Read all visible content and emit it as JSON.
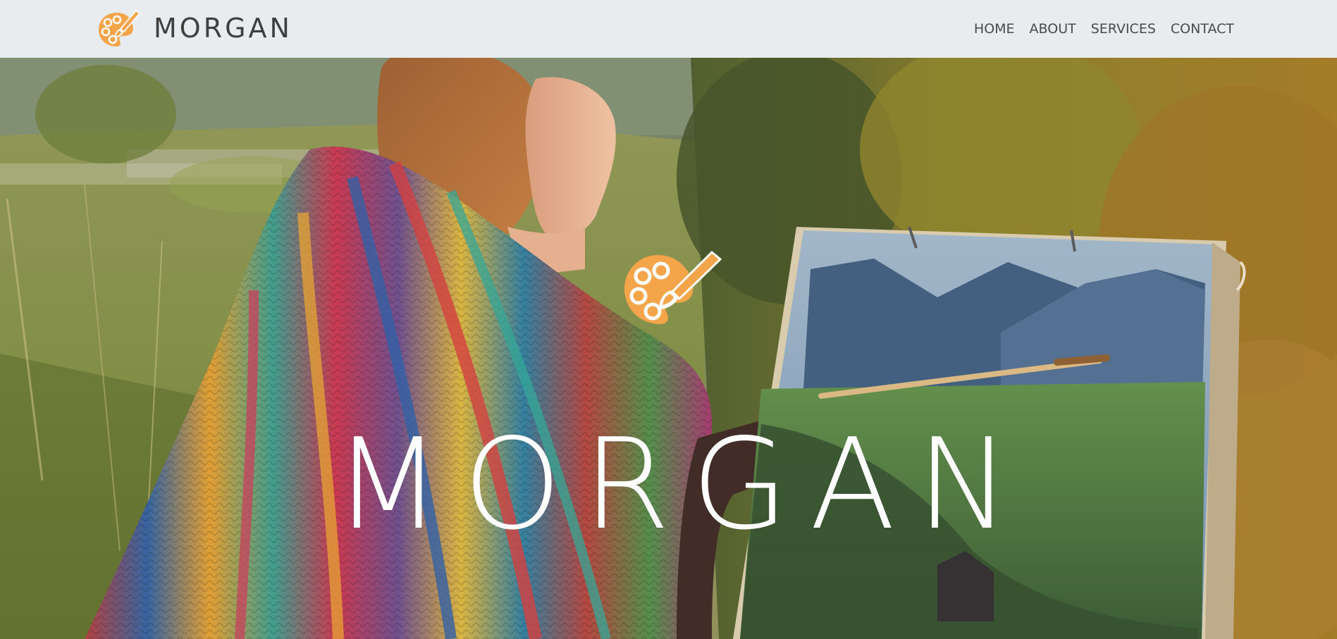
{
  "navbar": {
    "brand_name": "MORGAN",
    "logo_icon": "palette-brush-icon",
    "links": [
      {
        "label": "HOME"
      },
      {
        "label": "ABOUT"
      },
      {
        "label": "SERVICES"
      },
      {
        "label": "CONTACT"
      }
    ]
  },
  "hero": {
    "title": "MORGAN",
    "logo_icon": "palette-brush-icon",
    "photo": "woman-painting-landscape-on-easel"
  },
  "colors": {
    "navbar_bg": "#e9ecef",
    "accent_orange": "#f4a54a",
    "brand_text": "#3f3f3f",
    "hero_text": "#ffffff"
  }
}
